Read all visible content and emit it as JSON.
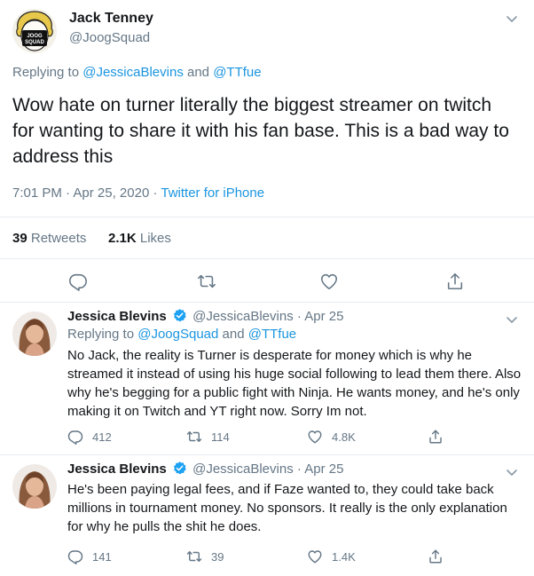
{
  "main_tweet": {
    "author_name": "Jack Tenney",
    "author_handle": "@JoogSquad",
    "avatar_text": [
      "JOOG",
      "SQUAD"
    ],
    "replying_prefix": "Replying to ",
    "replying_to": [
      "@JessicaBlevins",
      "@TTfue"
    ],
    "replying_joiner": " and ",
    "text": "Wow hate on turner literally the biggest streamer on twitch for wanting to share it with his fan base. This is a bad way to address this",
    "time": "7:01 PM",
    "date": "Apr 25, 2020",
    "separator": " · ",
    "source": "Twitter for iPhone",
    "retweets_count": "39",
    "retweets_label": "Retweets",
    "likes_count": "2.1K",
    "likes_label": "Likes"
  },
  "replies": [
    {
      "author_name": "Jessica Blevins",
      "author_handle": "@JessicaBlevins",
      "separator": " · ",
      "date": "Apr 25",
      "replying_prefix": "Replying to ",
      "replying_to": [
        "@JoogSquad",
        "@TTfue"
      ],
      "replying_joiner": " and ",
      "text": "No Jack, the reality is Turner is desperate for money which is why he streamed it instead of using his huge social following to lead them there. Also why he's begging for a public fight with Ninja. He wants money, and he's only making it on Twitch and YT right now. Sorry Im not.",
      "reply_count": "412",
      "retweet_count": "114",
      "like_count": "4.8K"
    },
    {
      "author_name": "Jessica Blevins",
      "author_handle": "@JessicaBlevins",
      "separator": " · ",
      "date": "Apr 25",
      "text": "He's been paying legal fees, and if Faze wanted to, they could take back millions in tournament money. No sponsors. It really is the only explanation for why he pulls the shit he does.",
      "reply_count": "141",
      "retweet_count": "39",
      "like_count": "1.4K"
    }
  ],
  "colors": {
    "text": "#14171a",
    "muted": "#657786",
    "link": "#1b95e0",
    "divider": "#e6ecf0",
    "verified": "#1da1f2"
  },
  "icons": {
    "menu": "chevron-down-icon",
    "reply": "reply-icon",
    "retweet": "retweet-icon",
    "like": "heart-icon",
    "share": "share-icon",
    "verified": "verified-badge-icon"
  }
}
